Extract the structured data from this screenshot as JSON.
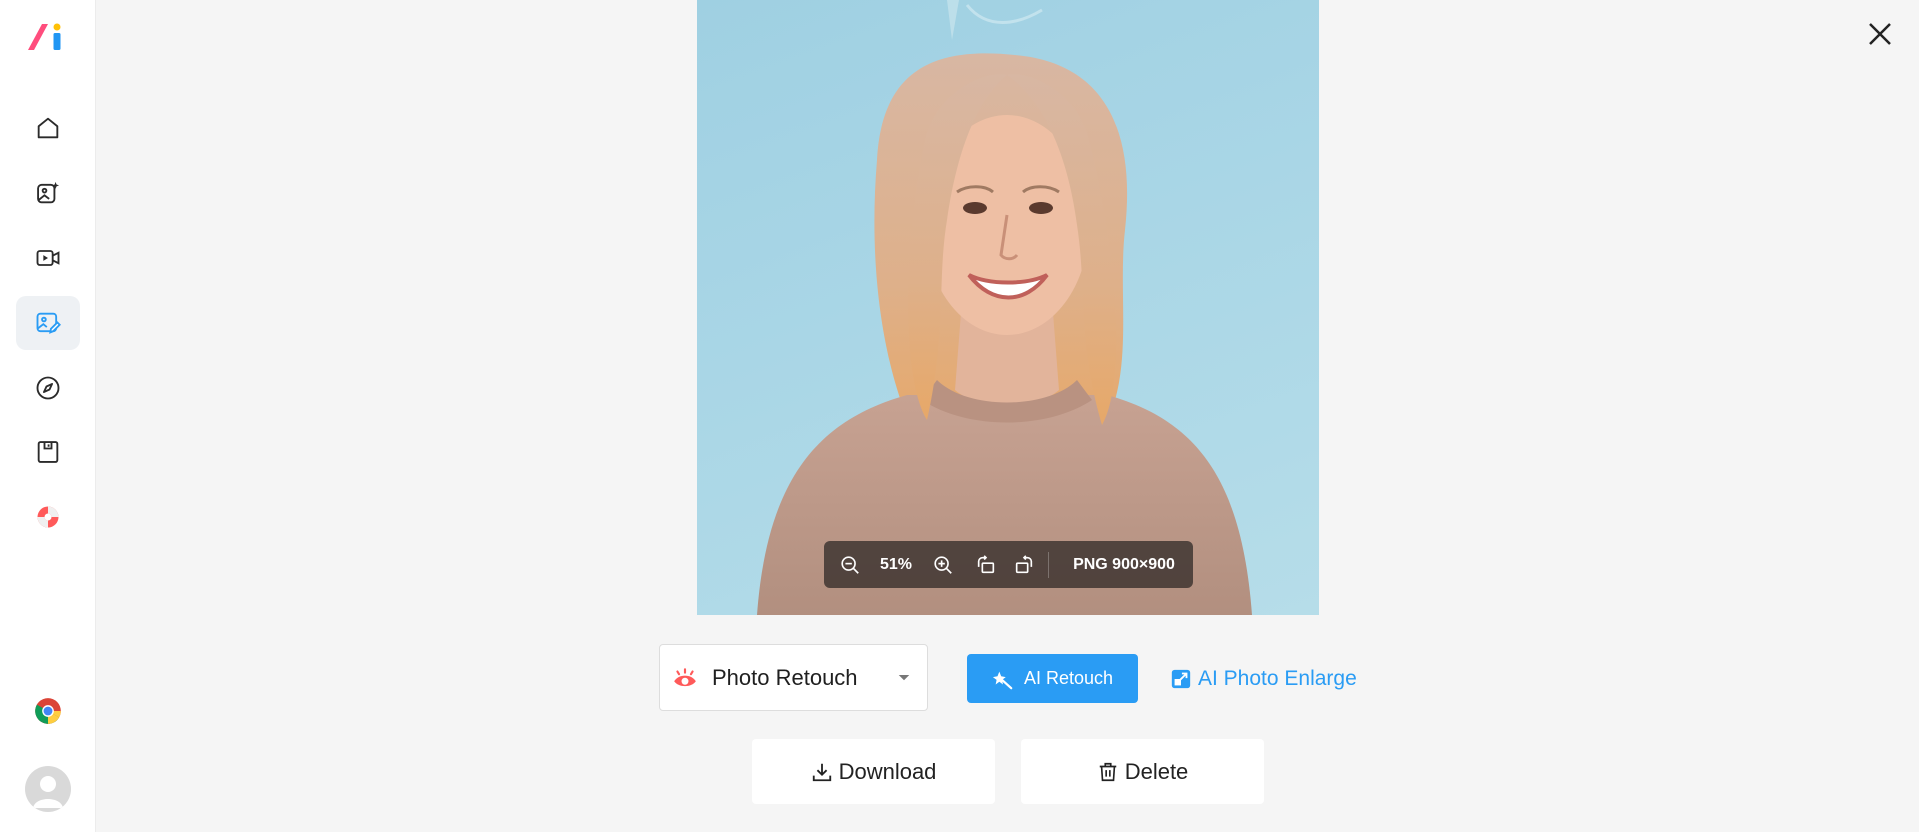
{
  "colors": {
    "accent": "#2a9cf4",
    "logo_pink": "#ff4d7d",
    "logo_blue": "#2196f3",
    "logo_yellow": "#ffc107"
  },
  "sidebar": {
    "items": [
      {
        "icon": "home-icon",
        "active": false
      },
      {
        "icon": "ai-image-icon",
        "active": false
      },
      {
        "icon": "video-icon",
        "active": false
      },
      {
        "icon": "photo-edit-icon",
        "active": true
      },
      {
        "icon": "compass-icon",
        "active": false
      },
      {
        "icon": "save-icon",
        "active": false
      },
      {
        "icon": "lifebuoy-icon",
        "active": false
      }
    ],
    "bottom": [
      "chrome-icon",
      "avatar"
    ]
  },
  "viewer": {
    "zoom": "51%",
    "format_info": "PNG 900×900"
  },
  "tools": {
    "mode_select": "Photo Retouch",
    "retouch_button": "AI Retouch",
    "enlarge_link": "AI Photo Enlarge"
  },
  "actions": {
    "download": "Download",
    "delete": "Delete"
  }
}
